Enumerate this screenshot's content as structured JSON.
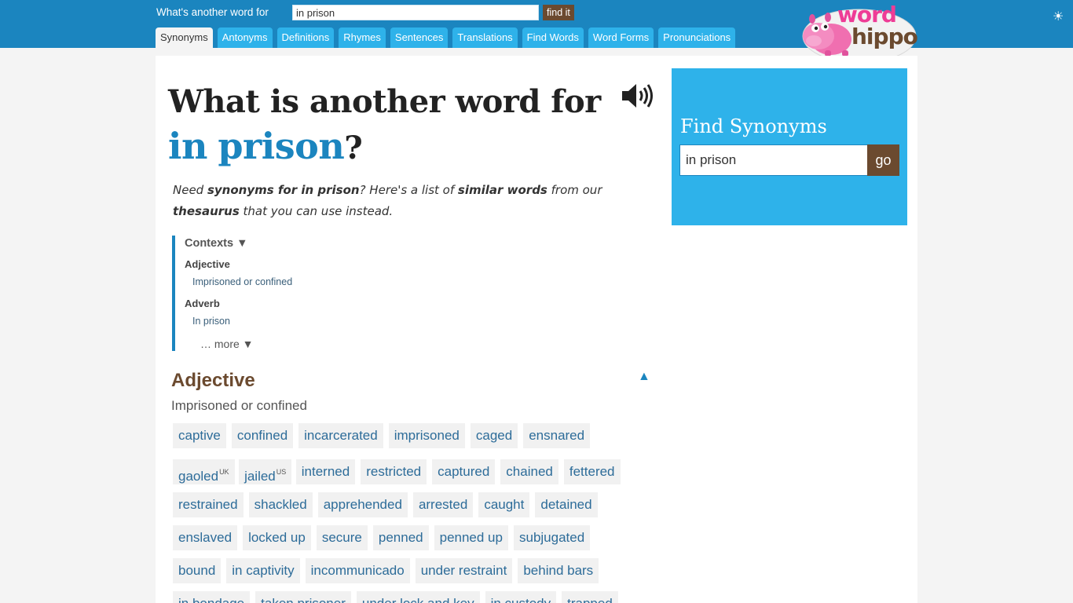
{
  "topbar": {
    "search_label": "What's another word for",
    "search_value": "in prison",
    "find_label": "find it",
    "theme_icon": "☀",
    "tabs": [
      {
        "label": "Synonyms",
        "active": true
      },
      {
        "label": "Antonyms"
      },
      {
        "label": "Definitions"
      },
      {
        "label": "Rhymes"
      },
      {
        "label": "Sentences"
      },
      {
        "label": "Translations"
      },
      {
        "label": "Find Words"
      },
      {
        "label": "Word Forms"
      },
      {
        "label": "Pronunciations"
      }
    ],
    "logo": {
      "word": "word",
      "hippo": "hippo"
    }
  },
  "heading": {
    "prefix": "What is another word for ",
    "term_a": "in",
    "term_b": "prison",
    "suffix": "?"
  },
  "intro": {
    "t1": "Need ",
    "b1": "synonyms for in prison",
    "t2": "? Here's a list of ",
    "b2": "similar words",
    "t3": " from our ",
    "b3": "thesaurus",
    "t4": " that you can use instead."
  },
  "contexts": {
    "title": "Contexts ▼",
    "groups": [
      {
        "pos": "Adjective",
        "item": "Imprisoned or confined"
      },
      {
        "pos": "Adverb",
        "item": "In prison"
      }
    ],
    "more": "… more ▼"
  },
  "section": {
    "title": "Adjective",
    "collapse": "▲",
    "subtitle": "Imprisoned or confined",
    "rows": [
      [
        "captive",
        "confined",
        "incarcerated",
        "imprisoned",
        "caged",
        "ensnared"
      ],
      [
        "gaoled|UK",
        "jailed|US",
        "interned",
        "restricted",
        "captured",
        "chained",
        "fettered"
      ],
      [
        "restrained",
        "shackled",
        "apprehended",
        "arrested",
        "caught",
        "detained"
      ],
      [
        "enslaved",
        "locked up",
        "secure",
        "penned",
        "penned up",
        "subjugated"
      ],
      [
        "bound",
        "in captivity",
        "incommunicado",
        "under restraint",
        "behind bars"
      ],
      [
        "in bondage",
        "taken prisoner",
        "under lock and key",
        "in custody",
        "trapped"
      ]
    ]
  },
  "sidebar": {
    "title": "Find Synonyms",
    "input_value": "in prison",
    "go_label": "go"
  }
}
